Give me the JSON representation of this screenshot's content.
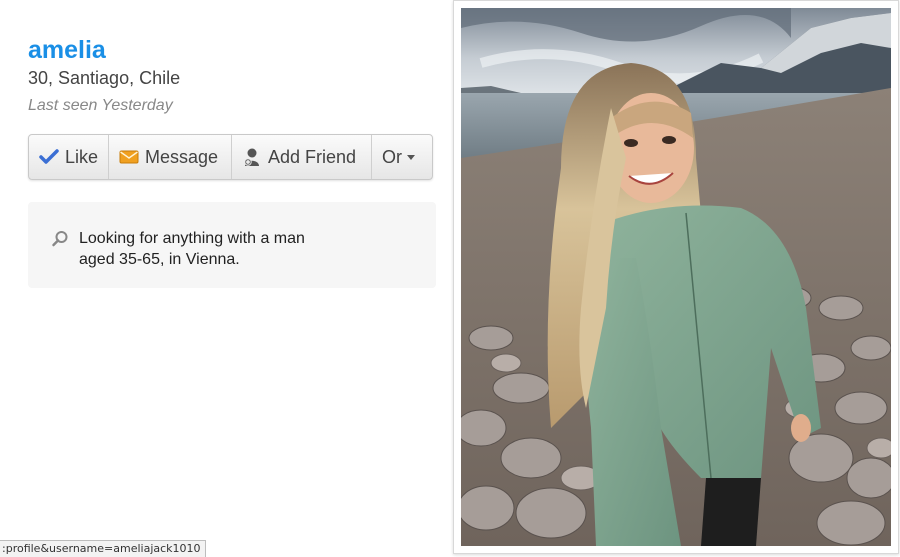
{
  "profile": {
    "name": "amelia",
    "meta": "30, Santiago, Chile",
    "last_seen": "Last seen Yesterday"
  },
  "actions": {
    "like": "Like",
    "message": "Message",
    "add_friend": "Add Friend",
    "or": "Or"
  },
  "looking_for": {
    "text": "Looking for anything with a man aged 35-65, in Vienna."
  },
  "status_bar": {
    "url": ":profile&username=ameliajack1010"
  },
  "colors": {
    "name_link": "#1a8fe6",
    "like_check": "#3b6fd4",
    "message_envelope": "#f0a020"
  },
  "icons": {
    "like": "checkmark-icon",
    "message": "envelope-icon",
    "add_friend": "person-add-icon",
    "or": "caret-down-icon",
    "looking_for": "search-icon"
  }
}
